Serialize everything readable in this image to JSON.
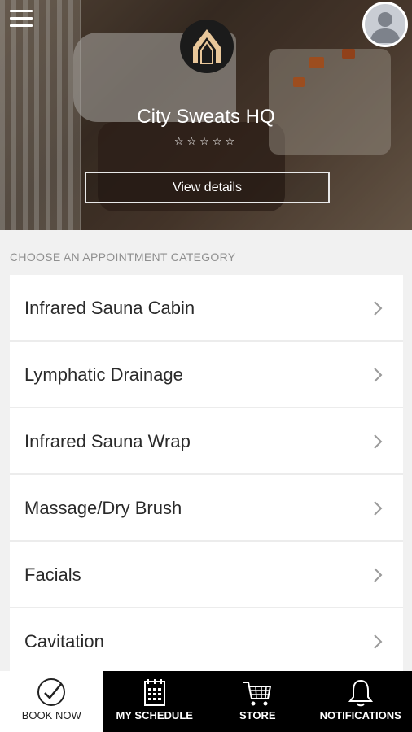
{
  "header": {
    "location_name": "City Sweats HQ",
    "rating_stars": "☆☆☆☆☆",
    "view_details_label": "View details"
  },
  "section": {
    "label": "CHOOSE AN APPOINTMENT CATEGORY"
  },
  "categories": [
    {
      "label": "Infrared Sauna Cabin"
    },
    {
      "label": "Lymphatic Drainage"
    },
    {
      "label": "Infrared Sauna Wrap"
    },
    {
      "label": "Massage/Dry Brush"
    },
    {
      "label": "Facials"
    },
    {
      "label": "Cavitation"
    }
  ],
  "tabs": [
    {
      "label": "BOOK NOW",
      "icon": "check-circle-icon",
      "active": true
    },
    {
      "label": "MY SCHEDULE",
      "icon": "calendar-icon",
      "active": false
    },
    {
      "label": "STORE",
      "icon": "cart-icon",
      "active": false
    },
    {
      "label": "NOTIFICATIONS",
      "icon": "bell-icon",
      "active": false
    }
  ],
  "colors": {
    "tabbar_bg": "#000000",
    "active_tab_bg": "#ffffff",
    "section_label": "#8f8f8f"
  }
}
